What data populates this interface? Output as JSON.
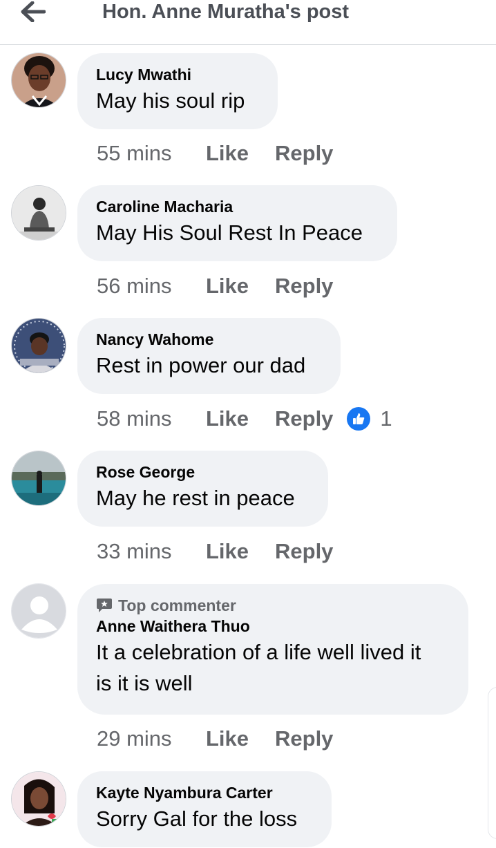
{
  "header": {
    "title": "Hon. Anne Muratha's post",
    "back_icon": "arrow-left-icon"
  },
  "actions": {
    "like_label": "Like",
    "reply_label": "Reply"
  },
  "comments": [
    {
      "author": "Lucy Mwathi",
      "text": "May his soul rip",
      "time": "55 mins"
    },
    {
      "author": "Caroline Macharia",
      "text": "May His Soul Rest In Peace",
      "time": "56 mins"
    },
    {
      "author": "Nancy Wahome",
      "text": "Rest in power our dad",
      "time": "58 mins",
      "reaction": {
        "icon": "like-reaction-icon",
        "count": "1"
      }
    },
    {
      "author": "Rose George",
      "text": "May he rest in peace",
      "time": "33 mins"
    },
    {
      "badge": "Top commenter",
      "author": "Anne Waithera Thuo",
      "text_line1": "It a celebration of a life well lived it",
      "text_line2": "is it is well",
      "time": "29 mins"
    },
    {
      "author": "Kayte Nyambura Carter",
      "text": "Sorry Gal for the loss"
    }
  ],
  "colors": {
    "accent": "#1877f2",
    "bubble": "#f0f2f5",
    "secondary_text": "#65676b"
  }
}
